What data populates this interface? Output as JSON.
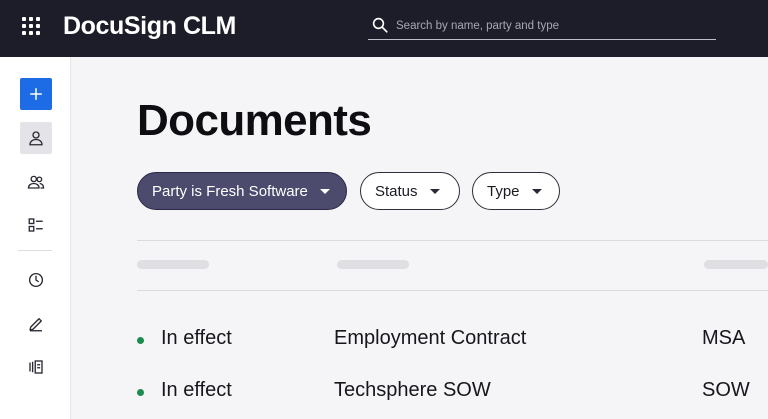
{
  "app": {
    "brand": "DocuSign CLM",
    "search_placeholder": "Search by name, party and type"
  },
  "sidebar": {
    "items": [
      {
        "name": "add-button",
        "icon": "plus-icon"
      },
      {
        "name": "sidebar-item-my-account",
        "icon": "user-icon",
        "active": true
      },
      {
        "name": "sidebar-item-parties",
        "icon": "users-icon"
      },
      {
        "name": "sidebar-item-tasks",
        "icon": "checklist-icon"
      },
      {
        "name": "sidebar-item-recent",
        "icon": "clock-icon"
      },
      {
        "name": "sidebar-item-drafts",
        "icon": "pencil-icon"
      },
      {
        "name": "sidebar-item-library",
        "icon": "library-icon"
      }
    ]
  },
  "page": {
    "title": "Documents"
  },
  "filters": [
    {
      "label": "Party is Fresh Software",
      "active": true
    },
    {
      "label": "Status",
      "active": false
    },
    {
      "label": "Type",
      "active": false
    }
  ],
  "table": {
    "rows": [
      {
        "status": "In effect",
        "name": "Employment Contract",
        "type": "MSA"
      },
      {
        "status": "In effect",
        "name": "Techsphere SOW",
        "type": "SOW"
      }
    ]
  },
  "colors": {
    "topbar": "#1d1d29",
    "accent_blue": "#1e6be6",
    "active_chip": "#4c4a6d",
    "status_green": "#1a8c4e"
  }
}
